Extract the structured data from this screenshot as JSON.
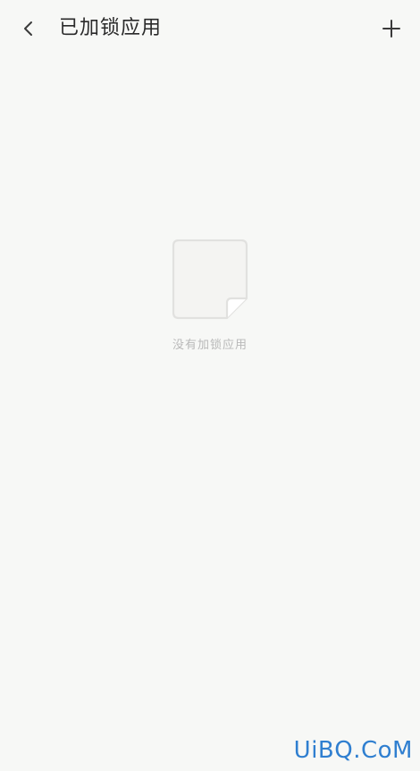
{
  "header": {
    "title": "已加锁应用",
    "back_icon": "chevron-left-icon",
    "add_icon": "plus-icon"
  },
  "empty_state": {
    "icon": "document-icon",
    "message": "没有加锁应用"
  },
  "watermark": {
    "text": "UiBQ.CoM"
  },
  "colors": {
    "background": "#f7f8f6",
    "title": "#2a2a2a",
    "icon": "#3a3a3a",
    "empty_text": "#b9b9b9",
    "watermark": "#2f7fd0"
  }
}
